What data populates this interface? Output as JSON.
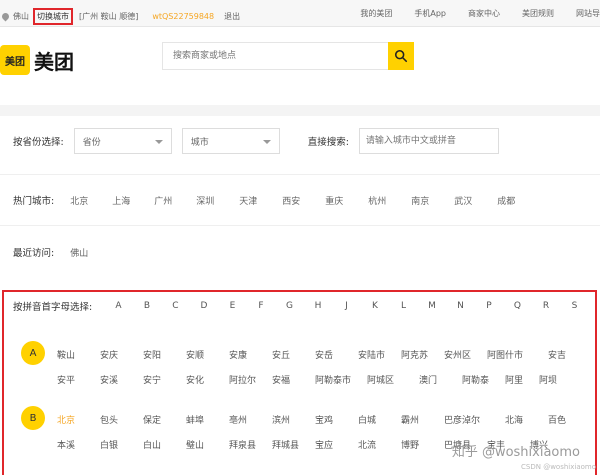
{
  "topbar": {
    "location": "佛山",
    "switch_city": "切换城市",
    "nearby": "[广州 鞍山 顺德]",
    "username": "wtQS22759848",
    "logout": "退出",
    "links": [
      "我的美团",
      "手机App",
      "商家中心",
      "美团规则",
      "网站导"
    ]
  },
  "header": {
    "logo_box": "美团",
    "logo_text": "美团",
    "search_placeholder": "搜索商家或地点"
  },
  "filter": {
    "province_label": "按省份选择:",
    "province_select": "省份",
    "city_select": "城市",
    "direct_label": "直接搜索:",
    "direct_placeholder": "请输入城市中文或拼音"
  },
  "hot": {
    "label": "热门城市:",
    "cities": [
      "北京",
      "上海",
      "广州",
      "深圳",
      "天津",
      "西安",
      "重庆",
      "杭州",
      "南京",
      "武汉",
      "成都"
    ]
  },
  "recent": {
    "label": "最近访问:",
    "cities": [
      "佛山"
    ]
  },
  "pinyin": {
    "label": "按拼音首字母选择:",
    "letters": [
      "A",
      "B",
      "C",
      "D",
      "E",
      "F",
      "G",
      "H",
      "J",
      "K",
      "L",
      "M",
      "N",
      "P",
      "Q",
      "R",
      "S"
    ],
    "groups": [
      {
        "letter": "A",
        "row1": [
          "鞍山",
          "安庆",
          "安阳",
          "安顺",
          "安康",
          "安丘",
          "安岳",
          "安陆市",
          "阿克苏",
          "安州区",
          "阿图什市",
          "安吉"
        ],
        "row2": [
          "安平",
          "安溪",
          "安宁",
          "安化",
          "阿拉尔",
          "安福",
          "阿勒泰市",
          "阿城区",
          "澳门",
          "阿勒泰",
          "阿里",
          "阿坝"
        ]
      },
      {
        "letter": "B",
        "row1": [
          "北京",
          "包头",
          "保定",
          "蚌埠",
          "亳州",
          "滨州",
          "宝鸡",
          "白城",
          "霸州",
          "巴彦淖尔",
          "北海",
          "百色"
        ],
        "row2": [
          "本溪",
          "白银",
          "白山",
          "璧山",
          "拜泉县",
          "拜城县",
          "宝应",
          "北流",
          "博野",
          "巴塘县",
          "宝丰",
          "博兴"
        ]
      }
    ]
  },
  "watermark": {
    "main": "知乎 @woshixiaomo",
    "sub": "CSDN @woshixiaomo"
  }
}
